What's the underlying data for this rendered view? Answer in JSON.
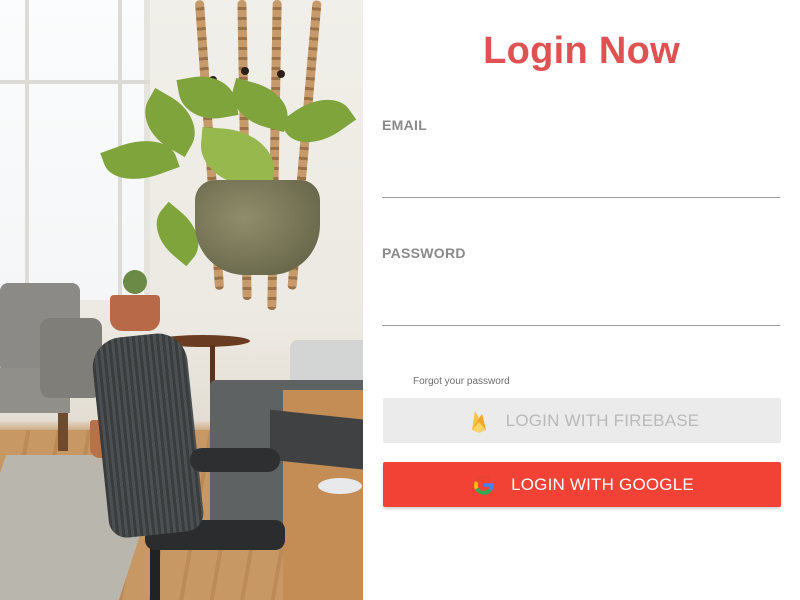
{
  "page": {
    "title": "Login Now"
  },
  "form": {
    "email": {
      "label": "EMAIL",
      "value": "",
      "placeholder": ""
    },
    "password": {
      "label": "PASSWORD",
      "value": "",
      "placeholder": ""
    },
    "forgot_password_label": "Forgot your password"
  },
  "buttons": {
    "firebase": {
      "label": "LOGIN WITH FIREBASE",
      "icon": "firebase-flame-icon",
      "state": "disabled"
    },
    "google": {
      "label": "LOGIN WITH GOOGLE",
      "icon": "google-g-icon"
    }
  },
  "colors": {
    "title": "#e05252",
    "label": "#8a8a8a",
    "google_button": "#f24135",
    "firebase_button": "#ebebeb",
    "firebase_text": "#b9b9b9"
  },
  "image": {
    "description_icon": "room-photo"
  }
}
